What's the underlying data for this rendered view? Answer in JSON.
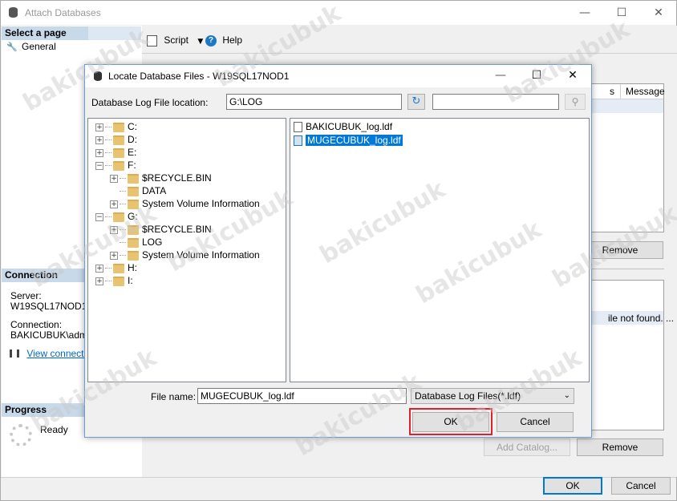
{
  "outer": {
    "title": "Attach Databases",
    "minimize_glyph": "—",
    "maximize_glyph": "☐",
    "close_glyph": "✕"
  },
  "left": {
    "select_page_header": "Select a page",
    "general_label": "General",
    "connection_header": "Connection",
    "server_label": "Server:",
    "server_value": "W19SQL17NOD1",
    "connection_label": "Connection:",
    "connection_value": "BAKICUBUK\\admin",
    "view_connection_link": "View connection",
    "progress_header": "Progress",
    "progress_status": "Ready"
  },
  "toolbar": {
    "script_label": "Script",
    "help_label": "Help"
  },
  "right": {
    "grid_col_partial": "s",
    "grid_col_message": "Message",
    "remove_top_label": "Remove",
    "status_text": "ile not found. ...",
    "add_catalog_label": "Add Catalog...",
    "remove_bottom_label": "Remove"
  },
  "footer": {
    "ok_label": "OK",
    "cancel_label": "Cancel"
  },
  "dialog": {
    "title": "Locate Database Files - W19SQL17NOD1",
    "minimize_glyph": "—",
    "maximize_glyph": "☐",
    "close_glyph": "✕",
    "location_label": "Database Log File location:",
    "location_value": "G:\\LOG",
    "search_value": "",
    "tree": [
      {
        "label": "C:",
        "level": 0,
        "expander": "+"
      },
      {
        "label": "D:",
        "level": 0,
        "expander": "+"
      },
      {
        "label": "E:",
        "level": 0,
        "expander": "+"
      },
      {
        "label": "F:",
        "level": 0,
        "expander": "−"
      },
      {
        "label": "$RECYCLE.BIN",
        "level": 1,
        "expander": "+"
      },
      {
        "label": "DATA",
        "level": 1,
        "expander": ""
      },
      {
        "label": "System Volume Information",
        "level": 1,
        "expander": "+"
      },
      {
        "label": "G:",
        "level": 0,
        "expander": "−"
      },
      {
        "label": "$RECYCLE.BIN",
        "level": 1,
        "expander": "+"
      },
      {
        "label": "LOG",
        "level": 1,
        "expander": ""
      },
      {
        "label": "System Volume Information",
        "level": 1,
        "expander": "+"
      },
      {
        "label": "H:",
        "level": 0,
        "expander": "+"
      },
      {
        "label": "I:",
        "level": 0,
        "expander": "+"
      }
    ],
    "files": [
      {
        "name": "BAKICUBUK_log.ldf",
        "selected": false
      },
      {
        "name": "MUGECUBUK_log.ldf",
        "selected": true
      }
    ],
    "filename_label": "File name:",
    "filename_value": "MUGECUBUK_log.ldf",
    "filetype_value": "Database Log Files(*.ldf)",
    "ok_label": "OK",
    "cancel_label": "Cancel"
  },
  "colors": {
    "accent": "#0078d7",
    "selection": "#0078d7",
    "highlight_border": "#e0202a",
    "link": "#0066cc"
  },
  "watermark": "bakicubuk"
}
